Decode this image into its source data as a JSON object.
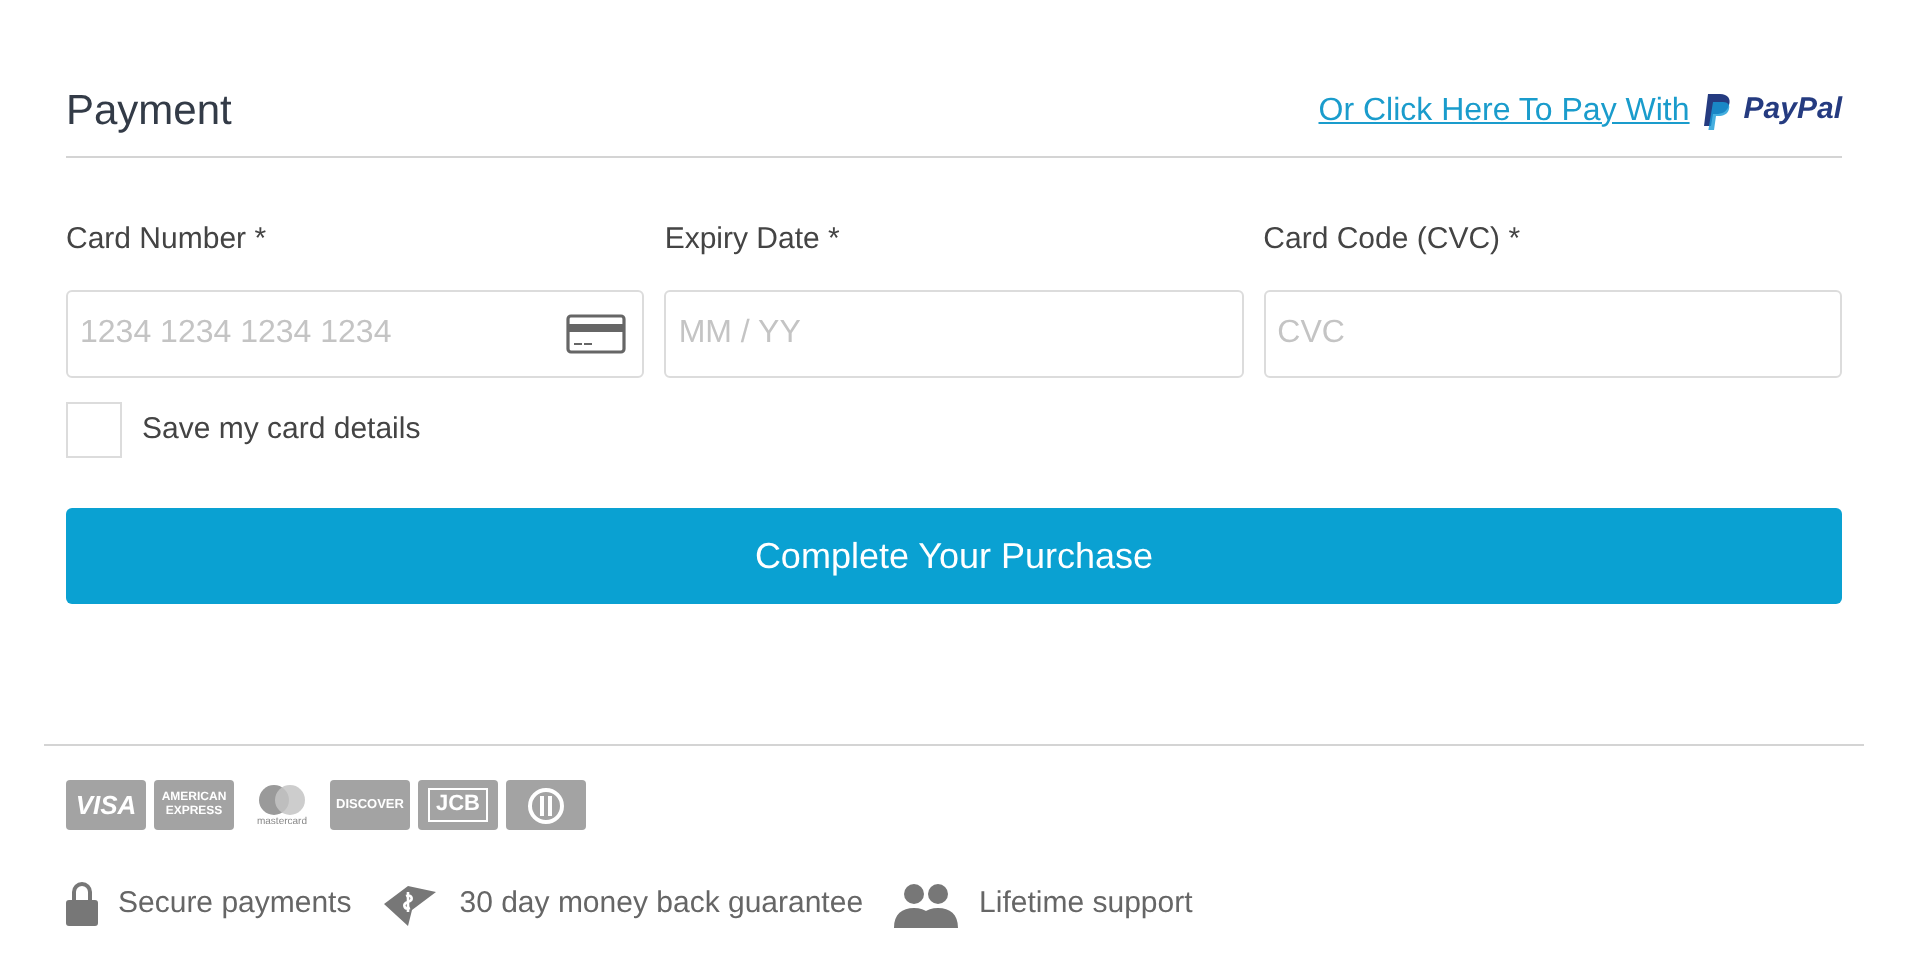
{
  "title": "Payment",
  "paypal_link": {
    "text": "Or Click Here To Pay With",
    "logo_text": "PayPal"
  },
  "fields": [
    {
      "label": "Card Number *",
      "placeholder": "1234 1234 1234 1234",
      "kind": "card"
    },
    {
      "label": "Expiry Date *",
      "placeholder": "MM / YY",
      "kind": "plain"
    },
    {
      "label": "Card Code (CVC) *",
      "placeholder": "CVC",
      "kind": "plain"
    }
  ],
  "save_card": {
    "label": "Save my card details",
    "checked": false
  },
  "submit": "Complete Your Purchase",
  "card_logos": [
    {
      "kind": "visa",
      "text": "VISA"
    },
    {
      "kind": "amex",
      "text": "AMERICAN EXPRESS"
    },
    {
      "kind": "mastercard",
      "text": "mastercard"
    },
    {
      "kind": "discover",
      "text": "DISCOVER"
    },
    {
      "kind": "jcb",
      "text": "JCB"
    },
    {
      "kind": "diners"
    }
  ],
  "features": [
    {
      "kind": "lock",
      "text": "Secure payments"
    },
    {
      "kind": "money",
      "text": "30 day money back guarantee"
    },
    {
      "kind": "people",
      "text": "Lifetime support"
    }
  ]
}
